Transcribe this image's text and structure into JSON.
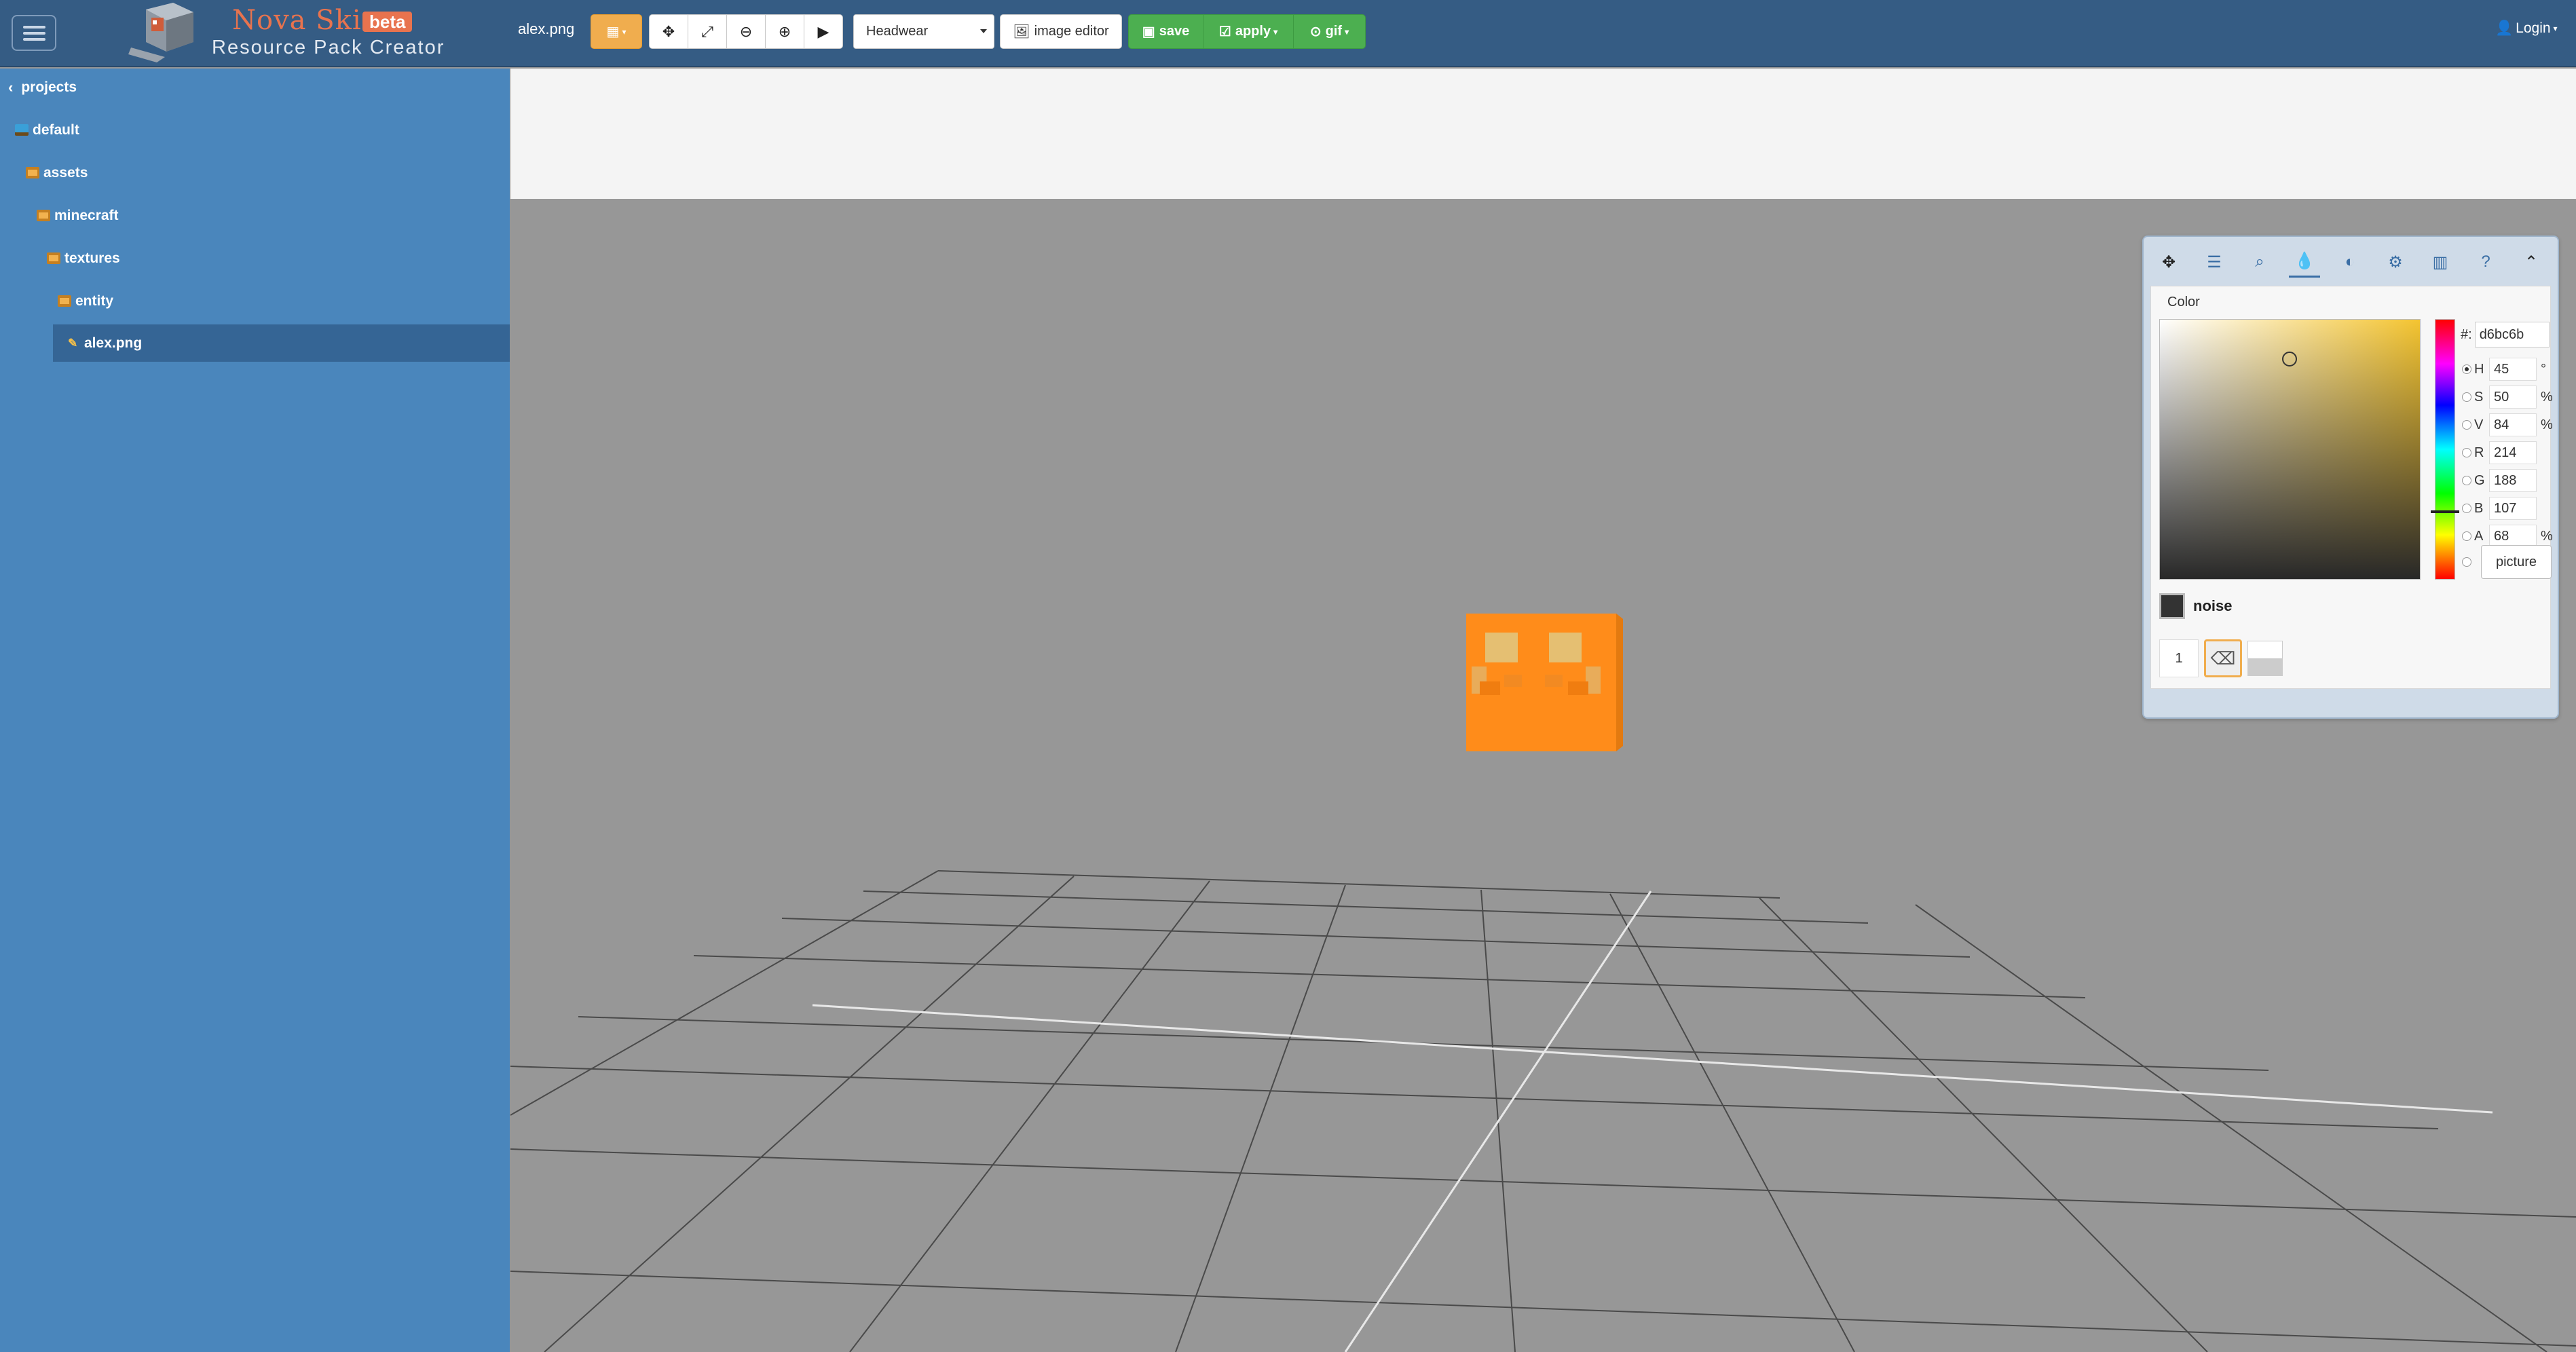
{
  "app": {
    "brand_title": "Nova Skin",
    "beta": "beta",
    "subtitle": "Resource Pack Creator",
    "filename": "alex.png"
  },
  "toolbar": {
    "select_value": "Headwear",
    "image_editor": "image editor",
    "save": "save",
    "apply": "apply",
    "gif": "gif",
    "login": "Login"
  },
  "sidebar": {
    "items": [
      {
        "label": "projects"
      },
      {
        "label": "default"
      },
      {
        "label": "assets"
      },
      {
        "label": "minecraft"
      },
      {
        "label": "textures"
      },
      {
        "label": "entity"
      },
      {
        "label": "alex.png"
      }
    ]
  },
  "color_panel": {
    "title": "Color",
    "hex_prefix": "#:",
    "hex": "d6bc6b",
    "channels": [
      {
        "label": "H",
        "value": "45",
        "unit": "°"
      },
      {
        "label": "S",
        "value": "50",
        "unit": "%"
      },
      {
        "label": "V",
        "value": "84",
        "unit": "%"
      },
      {
        "label": "R",
        "value": "214",
        "unit": ""
      },
      {
        "label": "G",
        "value": "188",
        "unit": ""
      },
      {
        "label": "B",
        "value": "107",
        "unit": ""
      },
      {
        "label": "A",
        "value": "68",
        "unit": "%"
      }
    ],
    "picture": "picture",
    "noise": "noise",
    "brush_size": "1"
  },
  "colors": {
    "navbar": "#355c84",
    "sidebar": "#4a86bc",
    "sidebar_selected": "#356595",
    "cube_orange": "#ff8c1a",
    "brand_orange": "#e8734e"
  }
}
